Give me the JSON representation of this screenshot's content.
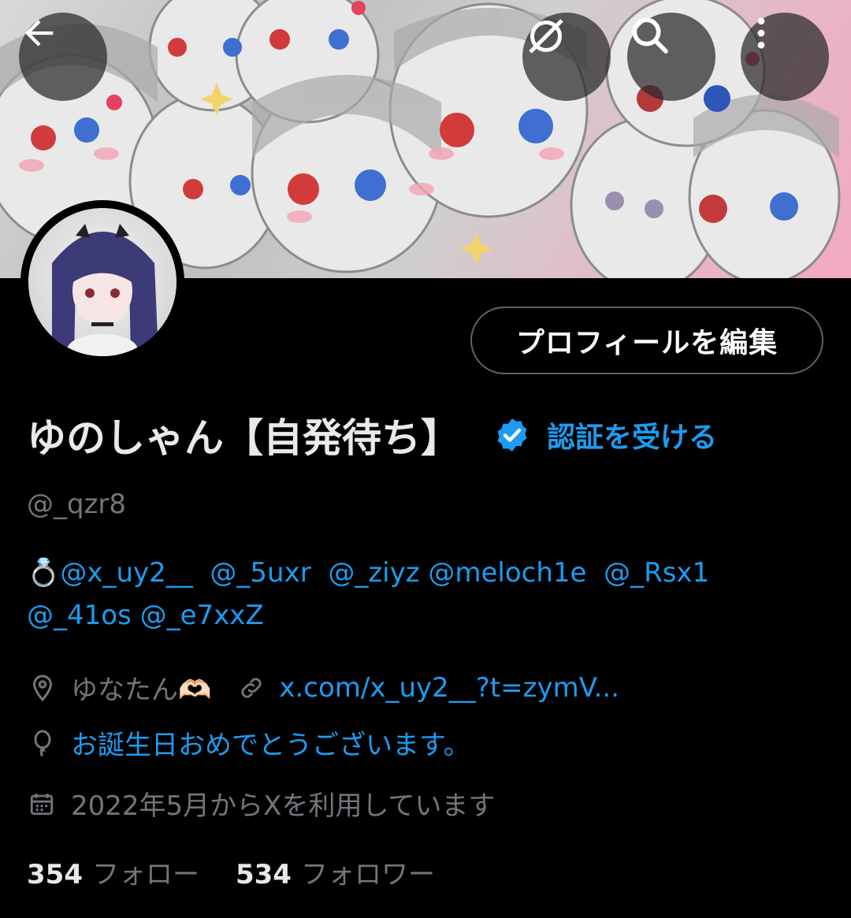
{
  "header": {
    "back_icon": "arrow-left-icon",
    "grok_icon": "grok-icon",
    "search_icon": "search-icon",
    "more_icon": "more-vertical-icon"
  },
  "profile": {
    "edit_label": "プロフィールを編集",
    "name": "ゆのしゃん【自発待ち】",
    "verify_label": "認証を受ける",
    "handle": "@_qzr8",
    "bio_emoji": "💍",
    "bio_mentions": [
      "@x_uy2__",
      "@_5uxr",
      "@_ziyz",
      "@meloch1e",
      "@_Rsx1",
      "@_41os",
      "@_e7xxZ"
    ],
    "location": "ゆなたん🫶🏻",
    "website": "x.com/x_uy2__?t=zymV...",
    "birthday": "お誕生日おめでとうございます。",
    "joined": "2022年5月からXを利用しています",
    "following_count": "354",
    "following_label": "フォロー",
    "followers_count": "534",
    "followers_label": "フォロワー"
  },
  "colors": {
    "accent": "#1d9bf0",
    "muted": "#71767b",
    "text": "#e7e9ea",
    "background": "#000000"
  }
}
